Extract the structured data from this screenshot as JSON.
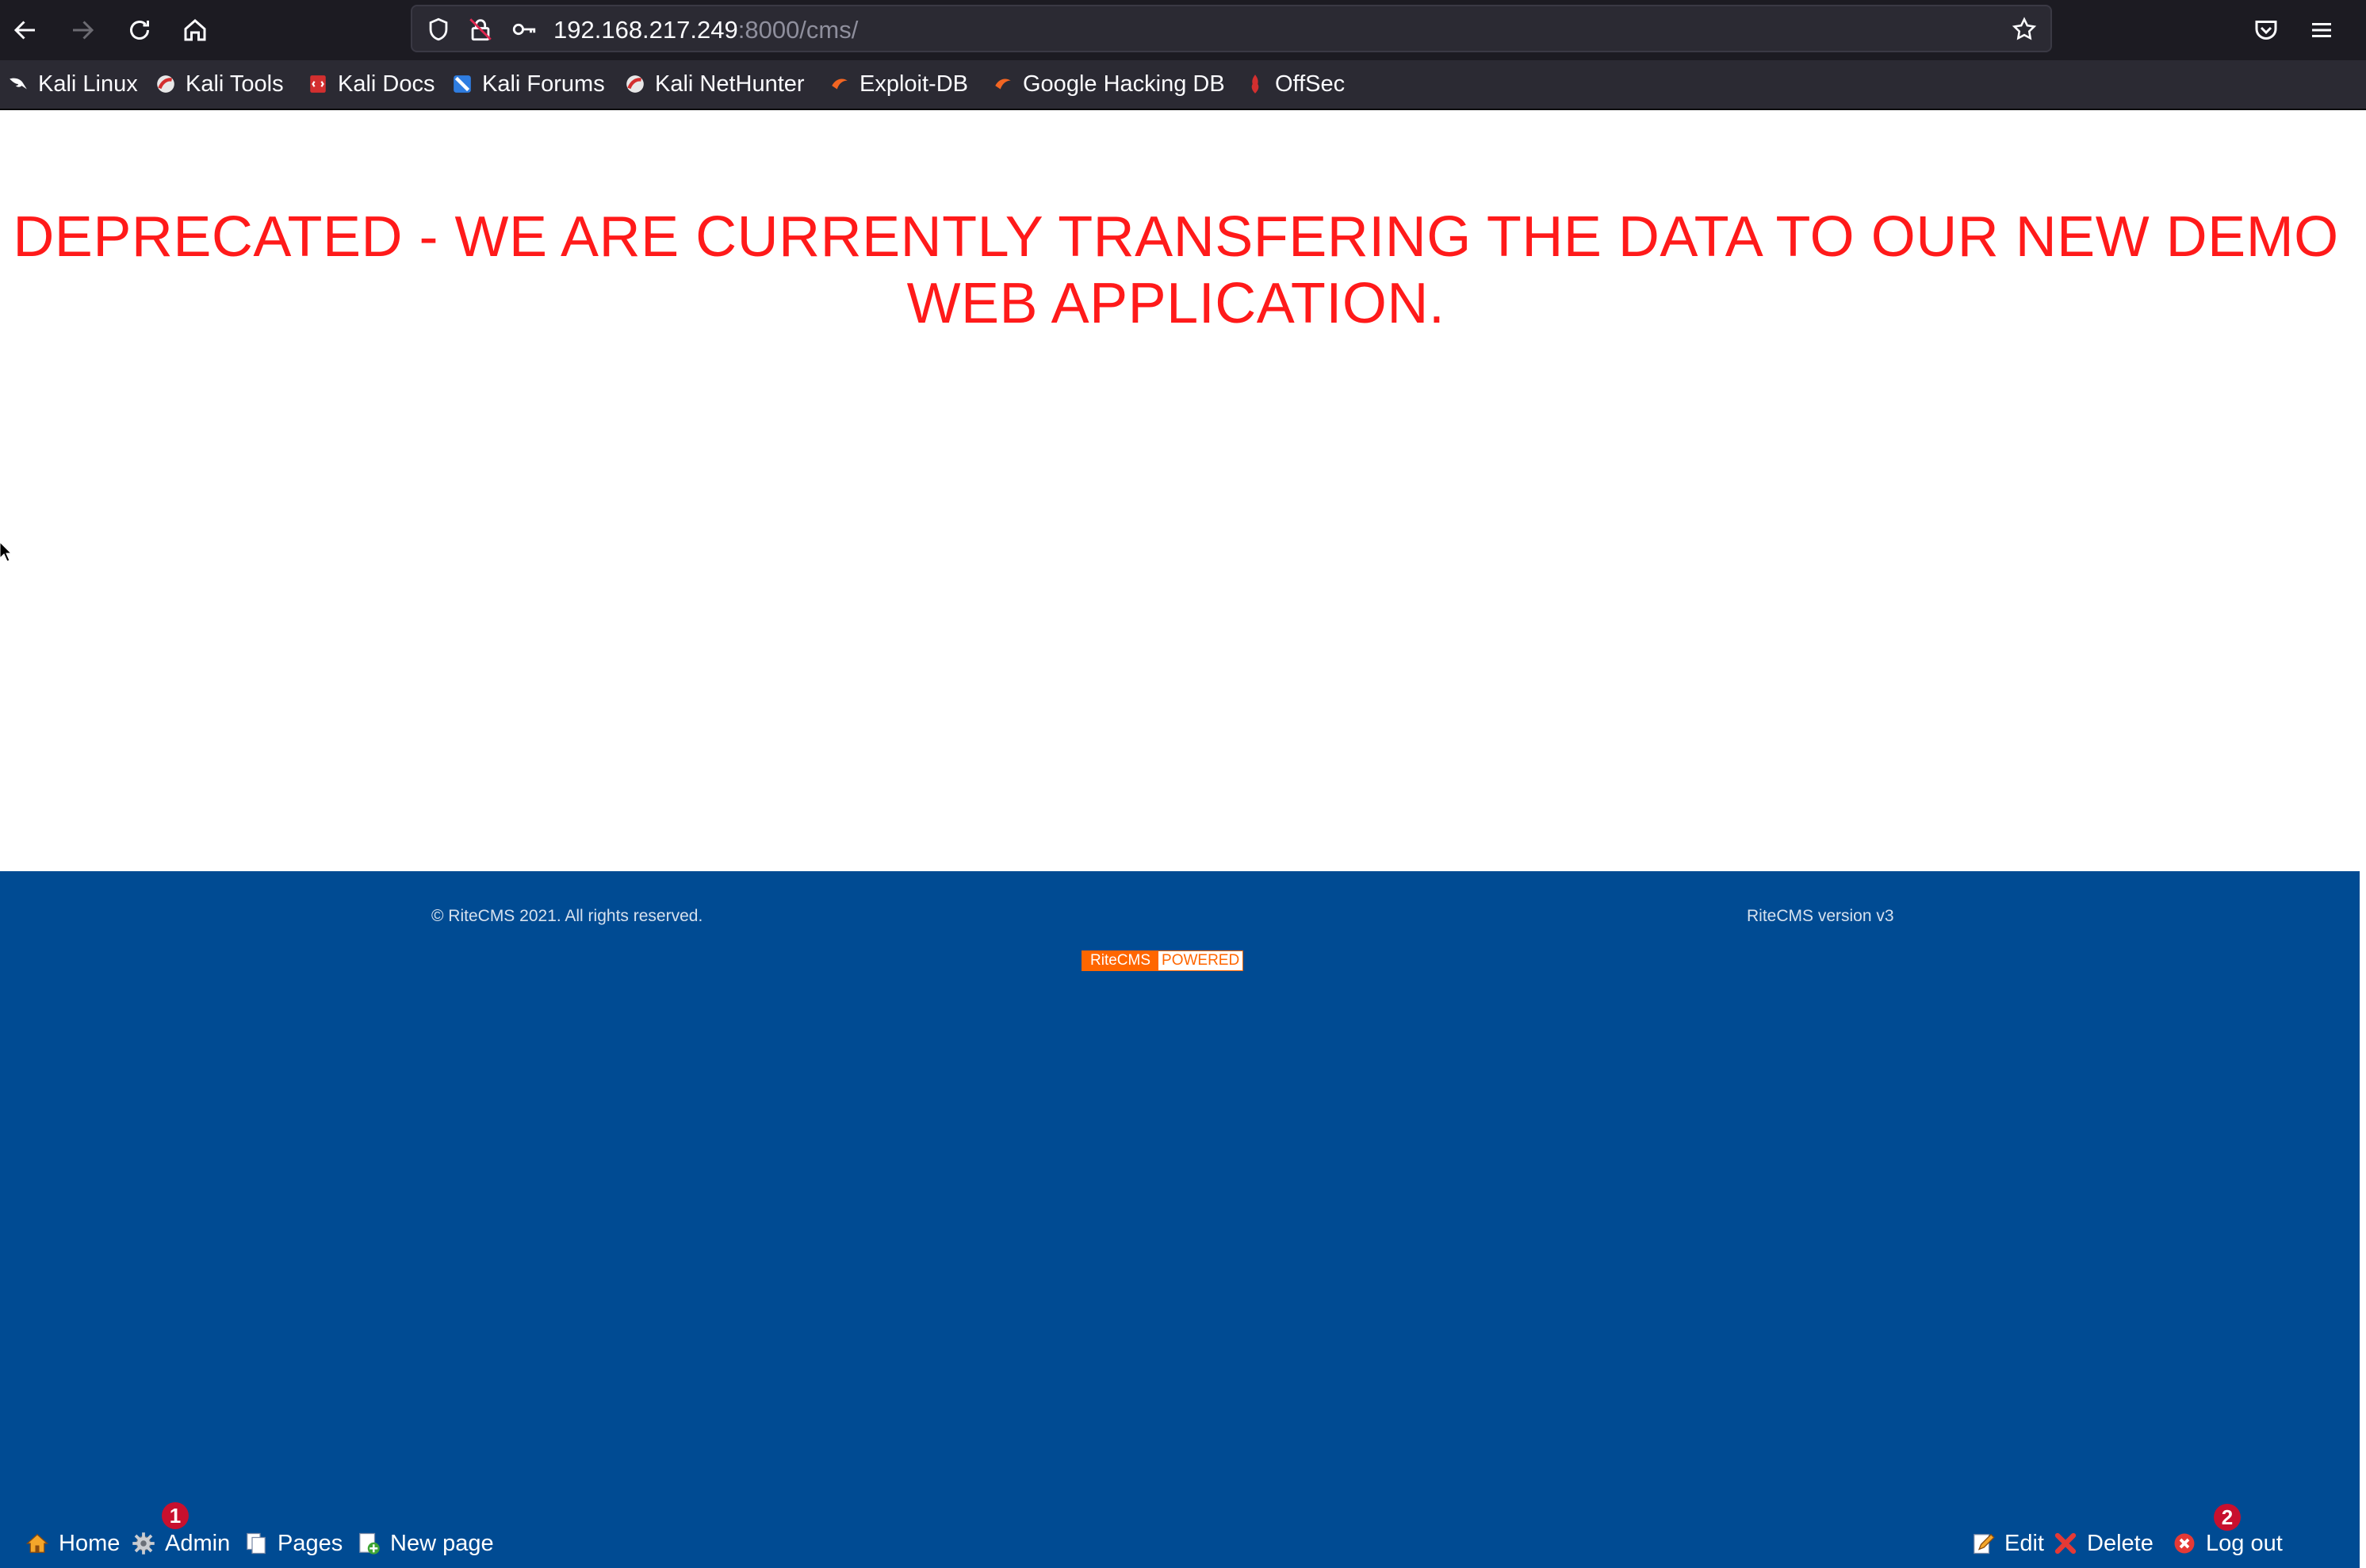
{
  "browser": {
    "url_host": "192.168.217.249",
    "url_path": ":8000/cms/",
    "bookmarks": [
      {
        "label": "Kali Linux",
        "icon": "kali-dragon-icon"
      },
      {
        "label": "Kali Tools",
        "icon": "kali-tools-icon"
      },
      {
        "label": "Kali Docs",
        "icon": "kali-docs-icon"
      },
      {
        "label": "Kali Forums",
        "icon": "kali-forums-icon"
      },
      {
        "label": "Kali NetHunter",
        "icon": "kali-nethunter-icon"
      },
      {
        "label": "Exploit-DB",
        "icon": "exploit-db-icon"
      },
      {
        "label": "Google Hacking DB",
        "icon": "ghdb-icon"
      },
      {
        "label": "OffSec",
        "icon": "offsec-icon"
      }
    ]
  },
  "page": {
    "notice_line1": "DEPRECATED - WE ARE CURRENTLY TRANSFERING THE DATA TO OUR NEW DEMO",
    "notice_line2": "WEB APPLICATION.",
    "notice_color": "#ff1a1a",
    "background": "#ffffff"
  },
  "footer": {
    "copyright": "© RiteCMS 2021. All rights reserved.",
    "version": "RiteCMS version v3",
    "badge_left": "RiteCMS",
    "badge_right": "POWERED",
    "background": "#004b93",
    "badge_color": "#ff6600"
  },
  "adminbar": {
    "home": "Home",
    "admin": "Admin",
    "pages": "Pages",
    "new_page": "New page",
    "edit": "Edit",
    "delete": "Delete",
    "logout": "Log out",
    "marker1": "1",
    "marker2": "2"
  }
}
